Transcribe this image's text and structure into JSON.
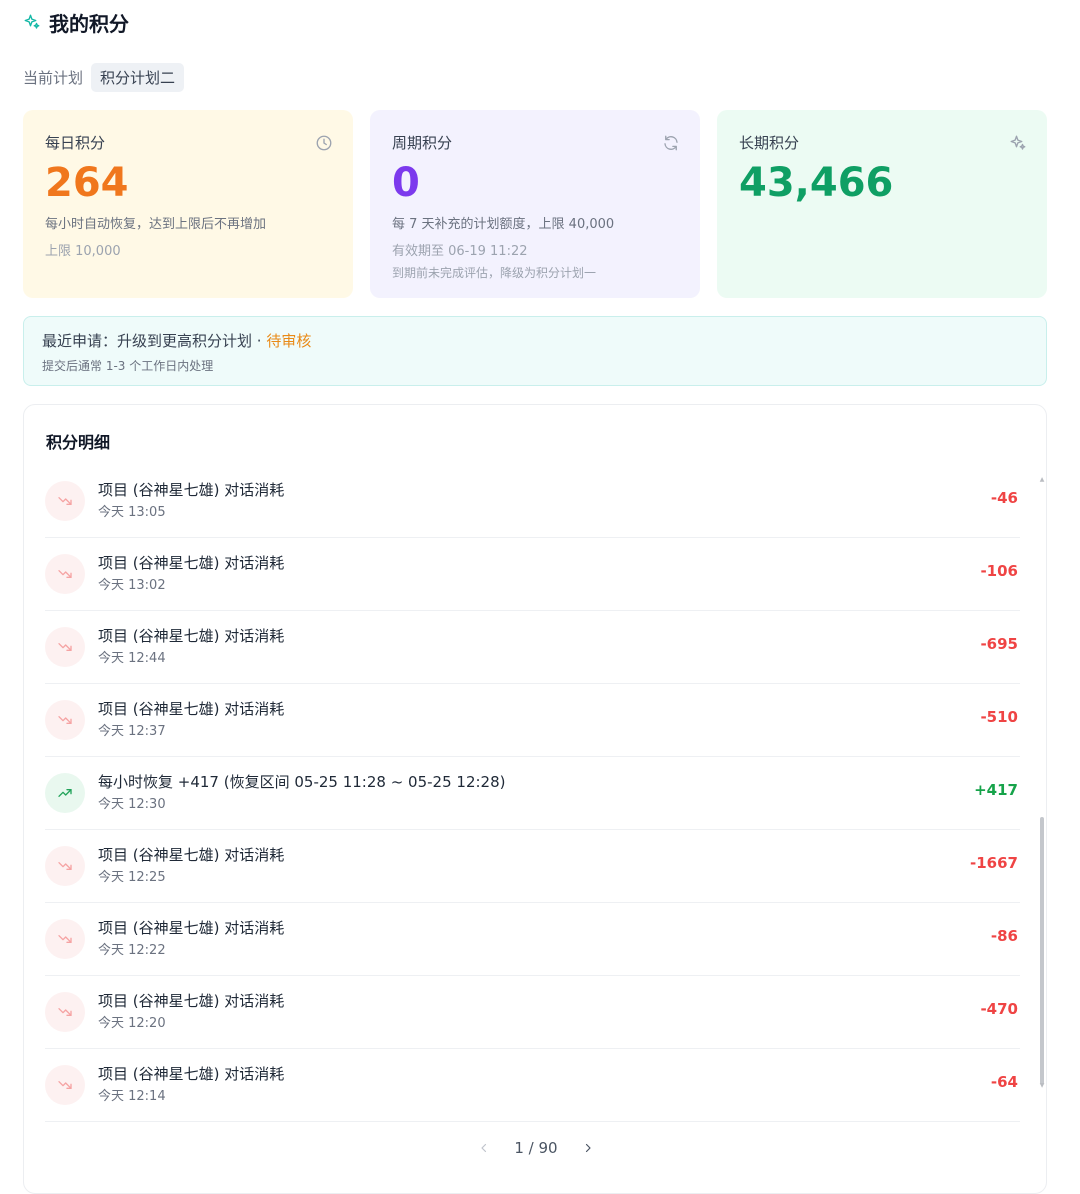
{
  "page": {
    "title": "我的积分",
    "title_icon": "sparkles-icon",
    "accent": "#14b8a6"
  },
  "plan": {
    "label": "当前计划",
    "name": "积分计划二"
  },
  "cards": {
    "daily": {
      "title": "每日积分",
      "icon": "clock-icon",
      "value": "264",
      "desc": "每小时自动恢复，达到上限后不再增加",
      "sub": "上限 10,000",
      "color": "#f0771d"
    },
    "period": {
      "title": "周期积分",
      "icon": "refresh-icon",
      "value": "0",
      "desc": "每 7 天补充的计划额度，上限 40,000",
      "sub": "有效期至 06-19 11:22",
      "sub2": "到期前未完成评估，降级为积分计划一",
      "color": "#7c3aed"
    },
    "long": {
      "title": "长期积分",
      "icon": "sparkles-icon",
      "value": "43,466",
      "color": "#0f9f64"
    }
  },
  "notice": {
    "prefix": "最近申请：升级到更高积分计划 · ",
    "status": "待审核",
    "sub": "提交后通常 1-3 个工作日内处理"
  },
  "detail": {
    "title": "积分明细",
    "rows": [
      {
        "type": "down",
        "title": "项目 (谷神星七雄) 对话消耗",
        "time": "今天 13:05",
        "amount": "-46"
      },
      {
        "type": "down",
        "title": "项目 (谷神星七雄) 对话消耗",
        "time": "今天 13:02",
        "amount": "-106"
      },
      {
        "type": "down",
        "title": "项目 (谷神星七雄) 对话消耗",
        "time": "今天 12:44",
        "amount": "-695"
      },
      {
        "type": "down",
        "title": "项目 (谷神星七雄) 对话消耗",
        "time": "今天 12:37",
        "amount": "-510"
      },
      {
        "type": "up",
        "title": "每小时恢复 +417 (恢复区间 05-25 11:28 ~ 05-25 12:28)",
        "time": "今天 12:30",
        "amount": "+417"
      },
      {
        "type": "down",
        "title": "项目 (谷神星七雄) 对话消耗",
        "time": "今天 12:25",
        "amount": "-1667"
      },
      {
        "type": "down",
        "title": "项目 (谷神星七雄) 对话消耗",
        "time": "今天 12:22",
        "amount": "-86"
      },
      {
        "type": "down",
        "title": "项目 (谷神星七雄) 对话消耗",
        "time": "今天 12:20",
        "amount": "-470"
      },
      {
        "type": "down",
        "title": "项目 (谷神星七雄) 对话消耗",
        "time": "今天 12:14",
        "amount": "-64"
      }
    ],
    "pager": {
      "text": "1 / 90",
      "prev_icon": "chevron-left-icon",
      "next_icon": "chevron-right-icon"
    }
  }
}
